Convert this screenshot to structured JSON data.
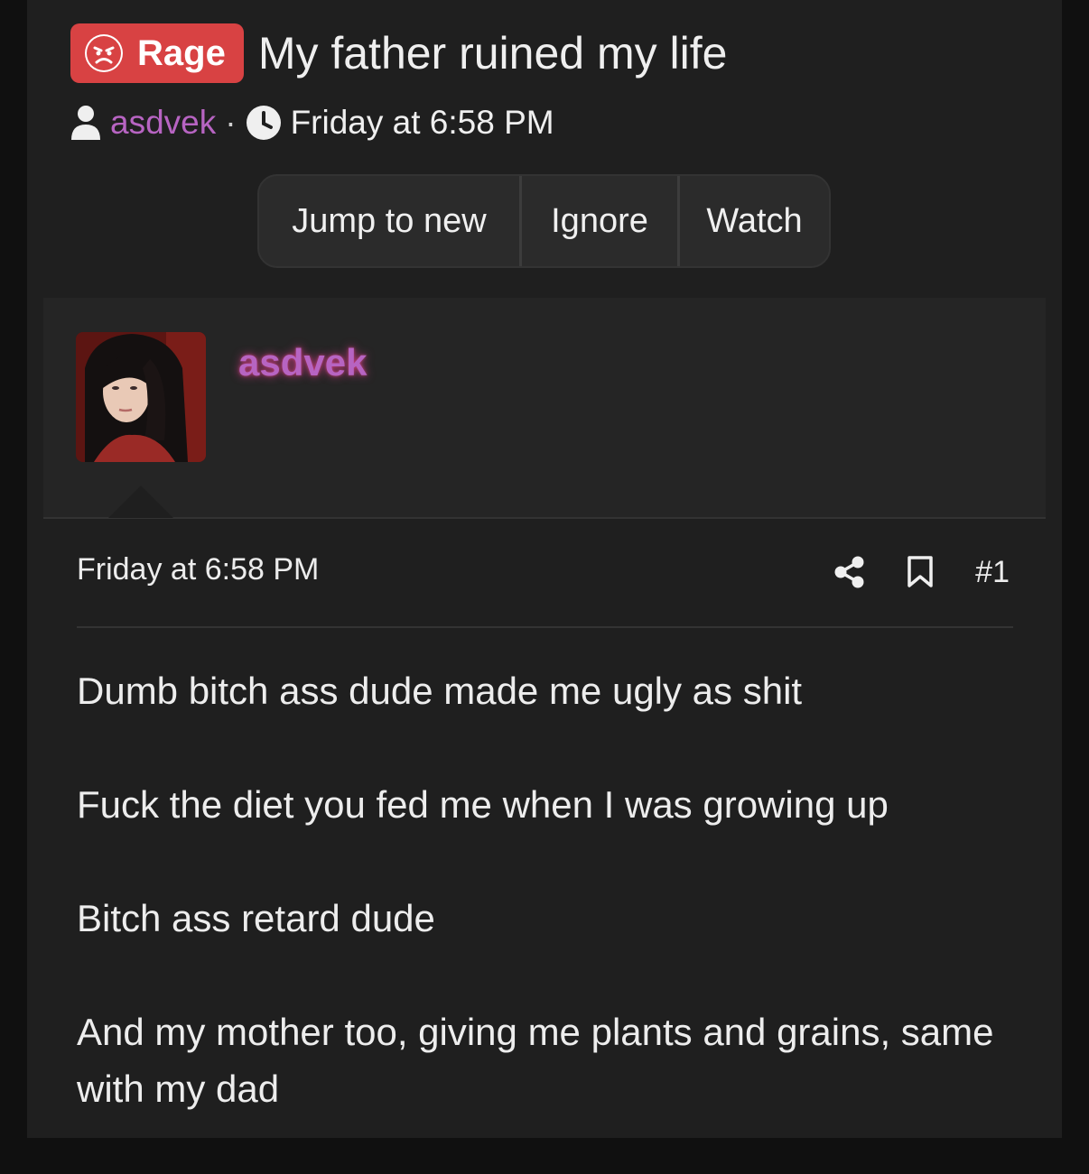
{
  "thread": {
    "prefix": "Rage",
    "title": "My father ruined my life",
    "author": "asdvek",
    "separator": "·",
    "date": "Friday at 6:58 PM"
  },
  "actions": {
    "jump_to_new": "Jump to new",
    "ignore": "Ignore",
    "watch": "Watch"
  },
  "post": {
    "username": "asdvek",
    "date": "Friday at 6:58 PM",
    "number": "#1",
    "paragraphs": [
      "Dumb bitch ass dude made me ugly as shit",
      "Fuck the diet you fed me when I was growing up",
      "Bitch ass retard dude",
      "And my mother too, giving me plants and grains, same with my dad"
    ]
  },
  "icons": {
    "prefix": "angry-face-icon",
    "author": "user-icon",
    "date": "clock-icon",
    "share": "share-icon",
    "bookmark": "bookmark-icon"
  },
  "colors": {
    "prefix_bg": "#d84243",
    "username": "#b764c2",
    "username_glow": "#e0408c",
    "background": "#1f1f1f"
  }
}
